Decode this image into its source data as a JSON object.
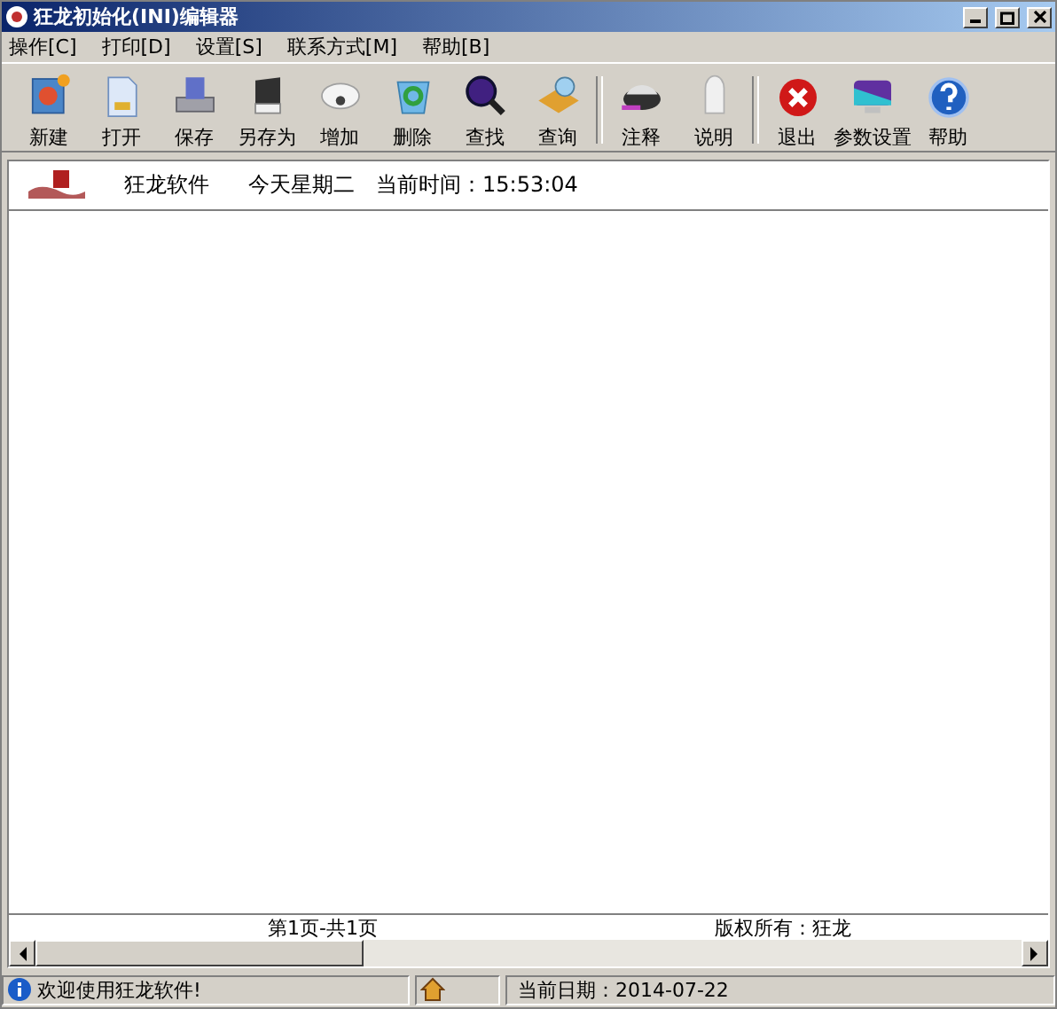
{
  "window": {
    "title": "狂龙初始化(INI)编辑器"
  },
  "menu": [
    "操作[C]",
    "打印[D]",
    "设置[S]",
    "联系方式[M]",
    "帮助[B]"
  ],
  "toolbar": [
    {
      "kind": "button",
      "label": "新建"
    },
    {
      "kind": "button",
      "label": "打开"
    },
    {
      "kind": "button",
      "label": "保存"
    },
    {
      "kind": "button",
      "label": "另存为"
    },
    {
      "kind": "button",
      "label": "增加"
    },
    {
      "kind": "button",
      "label": "删除"
    },
    {
      "kind": "button",
      "label": "查找"
    },
    {
      "kind": "button",
      "label": "查询"
    },
    {
      "kind": "separator"
    },
    {
      "kind": "button",
      "label": "注释"
    },
    {
      "kind": "button",
      "label": "说明"
    },
    {
      "kind": "separator"
    },
    {
      "kind": "button",
      "label": "退出"
    },
    {
      "kind": "button",
      "label": "参数设置"
    },
    {
      "kind": "button",
      "label": "帮助"
    }
  ],
  "header": {
    "brand": "狂龙软件",
    "weekday": "今天星期二",
    "time": "当前时间：15:53:04"
  },
  "footer": {
    "page": "第1页-共1页",
    "copyright": "版权所有：狂龙"
  },
  "status_bar": {
    "message": "欢迎使用狂龙软件!",
    "date": "当前日期：2014-07-22"
  }
}
